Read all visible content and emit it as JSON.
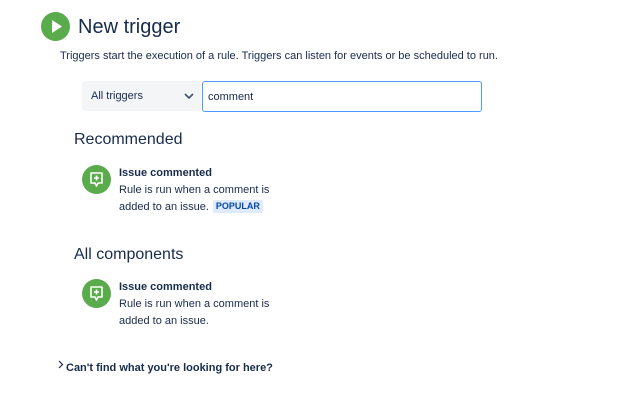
{
  "header": {
    "icon": "play-icon",
    "title": "New trigger",
    "description": "Triggers start the execution of a rule. Triggers can listen for events or be scheduled to run."
  },
  "filter": {
    "selected": "All triggers",
    "search_value": "comment"
  },
  "recommended": {
    "heading": "Recommended",
    "items": [
      {
        "icon": "comment-add-icon",
        "title": "Issue commented",
        "description": "Rule is run when a comment is added to an issue.",
        "badge": "POPULAR"
      }
    ]
  },
  "all_components": {
    "heading": "All components",
    "items": [
      {
        "icon": "comment-add-icon",
        "title": "Issue commented",
        "description": "Rule is run when a comment is added to an issue."
      }
    ]
  },
  "help": {
    "label": "Can't find what you're looking for here?"
  },
  "colors": {
    "accent_green": "#5aab4b",
    "focus_border": "#4c9aff",
    "badge_bg": "#deebff",
    "badge_text": "#0747a6",
    "text": "#172b4d"
  }
}
